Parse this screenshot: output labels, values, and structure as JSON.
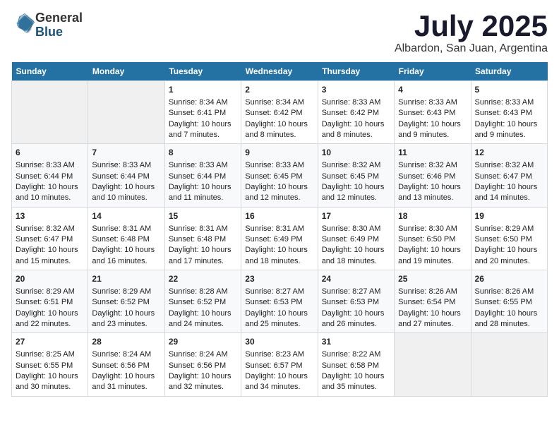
{
  "header": {
    "logo_line1": "General",
    "logo_line2": "Blue",
    "month_title": "July 2025",
    "location": "Albardon, San Juan, Argentina"
  },
  "days_of_week": [
    "Sunday",
    "Monday",
    "Tuesday",
    "Wednesday",
    "Thursday",
    "Friday",
    "Saturday"
  ],
  "weeks": [
    [
      {
        "day": "",
        "sunrise": "",
        "sunset": "",
        "daylight": "",
        "empty": true
      },
      {
        "day": "",
        "sunrise": "",
        "sunset": "",
        "daylight": "",
        "empty": true
      },
      {
        "day": "1",
        "sunrise": "Sunrise: 8:34 AM",
        "sunset": "Sunset: 6:41 PM",
        "daylight": "Daylight: 10 hours and 7 minutes."
      },
      {
        "day": "2",
        "sunrise": "Sunrise: 8:34 AM",
        "sunset": "Sunset: 6:42 PM",
        "daylight": "Daylight: 10 hours and 8 minutes."
      },
      {
        "day": "3",
        "sunrise": "Sunrise: 8:33 AM",
        "sunset": "Sunset: 6:42 PM",
        "daylight": "Daylight: 10 hours and 8 minutes."
      },
      {
        "day": "4",
        "sunrise": "Sunrise: 8:33 AM",
        "sunset": "Sunset: 6:43 PM",
        "daylight": "Daylight: 10 hours and 9 minutes."
      },
      {
        "day": "5",
        "sunrise": "Sunrise: 8:33 AM",
        "sunset": "Sunset: 6:43 PM",
        "daylight": "Daylight: 10 hours and 9 minutes."
      }
    ],
    [
      {
        "day": "6",
        "sunrise": "Sunrise: 8:33 AM",
        "sunset": "Sunset: 6:44 PM",
        "daylight": "Daylight: 10 hours and 10 minutes."
      },
      {
        "day": "7",
        "sunrise": "Sunrise: 8:33 AM",
        "sunset": "Sunset: 6:44 PM",
        "daylight": "Daylight: 10 hours and 10 minutes."
      },
      {
        "day": "8",
        "sunrise": "Sunrise: 8:33 AM",
        "sunset": "Sunset: 6:44 PM",
        "daylight": "Daylight: 10 hours and 11 minutes."
      },
      {
        "day": "9",
        "sunrise": "Sunrise: 8:33 AM",
        "sunset": "Sunset: 6:45 PM",
        "daylight": "Daylight: 10 hours and 12 minutes."
      },
      {
        "day": "10",
        "sunrise": "Sunrise: 8:32 AM",
        "sunset": "Sunset: 6:45 PM",
        "daylight": "Daylight: 10 hours and 12 minutes."
      },
      {
        "day": "11",
        "sunrise": "Sunrise: 8:32 AM",
        "sunset": "Sunset: 6:46 PM",
        "daylight": "Daylight: 10 hours and 13 minutes."
      },
      {
        "day": "12",
        "sunrise": "Sunrise: 8:32 AM",
        "sunset": "Sunset: 6:47 PM",
        "daylight": "Daylight: 10 hours and 14 minutes."
      }
    ],
    [
      {
        "day": "13",
        "sunrise": "Sunrise: 8:32 AM",
        "sunset": "Sunset: 6:47 PM",
        "daylight": "Daylight: 10 hours and 15 minutes."
      },
      {
        "day": "14",
        "sunrise": "Sunrise: 8:31 AM",
        "sunset": "Sunset: 6:48 PM",
        "daylight": "Daylight: 10 hours and 16 minutes."
      },
      {
        "day": "15",
        "sunrise": "Sunrise: 8:31 AM",
        "sunset": "Sunset: 6:48 PM",
        "daylight": "Daylight: 10 hours and 17 minutes."
      },
      {
        "day": "16",
        "sunrise": "Sunrise: 8:31 AM",
        "sunset": "Sunset: 6:49 PM",
        "daylight": "Daylight: 10 hours and 18 minutes."
      },
      {
        "day": "17",
        "sunrise": "Sunrise: 8:30 AM",
        "sunset": "Sunset: 6:49 PM",
        "daylight": "Daylight: 10 hours and 18 minutes."
      },
      {
        "day": "18",
        "sunrise": "Sunrise: 8:30 AM",
        "sunset": "Sunset: 6:50 PM",
        "daylight": "Daylight: 10 hours and 19 minutes."
      },
      {
        "day": "19",
        "sunrise": "Sunrise: 8:29 AM",
        "sunset": "Sunset: 6:50 PM",
        "daylight": "Daylight: 10 hours and 20 minutes."
      }
    ],
    [
      {
        "day": "20",
        "sunrise": "Sunrise: 8:29 AM",
        "sunset": "Sunset: 6:51 PM",
        "daylight": "Daylight: 10 hours and 22 minutes."
      },
      {
        "day": "21",
        "sunrise": "Sunrise: 8:29 AM",
        "sunset": "Sunset: 6:52 PM",
        "daylight": "Daylight: 10 hours and 23 minutes."
      },
      {
        "day": "22",
        "sunrise": "Sunrise: 8:28 AM",
        "sunset": "Sunset: 6:52 PM",
        "daylight": "Daylight: 10 hours and 24 minutes."
      },
      {
        "day": "23",
        "sunrise": "Sunrise: 8:27 AM",
        "sunset": "Sunset: 6:53 PM",
        "daylight": "Daylight: 10 hours and 25 minutes."
      },
      {
        "day": "24",
        "sunrise": "Sunrise: 8:27 AM",
        "sunset": "Sunset: 6:53 PM",
        "daylight": "Daylight: 10 hours and 26 minutes."
      },
      {
        "day": "25",
        "sunrise": "Sunrise: 8:26 AM",
        "sunset": "Sunset: 6:54 PM",
        "daylight": "Daylight: 10 hours and 27 minutes."
      },
      {
        "day": "26",
        "sunrise": "Sunrise: 8:26 AM",
        "sunset": "Sunset: 6:55 PM",
        "daylight": "Daylight: 10 hours and 28 minutes."
      }
    ],
    [
      {
        "day": "27",
        "sunrise": "Sunrise: 8:25 AM",
        "sunset": "Sunset: 6:55 PM",
        "daylight": "Daylight: 10 hours and 30 minutes."
      },
      {
        "day": "28",
        "sunrise": "Sunrise: 8:24 AM",
        "sunset": "Sunset: 6:56 PM",
        "daylight": "Daylight: 10 hours and 31 minutes."
      },
      {
        "day": "29",
        "sunrise": "Sunrise: 8:24 AM",
        "sunset": "Sunset: 6:56 PM",
        "daylight": "Daylight: 10 hours and 32 minutes."
      },
      {
        "day": "30",
        "sunrise": "Sunrise: 8:23 AM",
        "sunset": "Sunset: 6:57 PM",
        "daylight": "Daylight: 10 hours and 34 minutes."
      },
      {
        "day": "31",
        "sunrise": "Sunrise: 8:22 AM",
        "sunset": "Sunset: 6:58 PM",
        "daylight": "Daylight: 10 hours and 35 minutes."
      },
      {
        "day": "",
        "sunrise": "",
        "sunset": "",
        "daylight": "",
        "empty": true
      },
      {
        "day": "",
        "sunrise": "",
        "sunset": "",
        "daylight": "",
        "empty": true
      }
    ]
  ]
}
